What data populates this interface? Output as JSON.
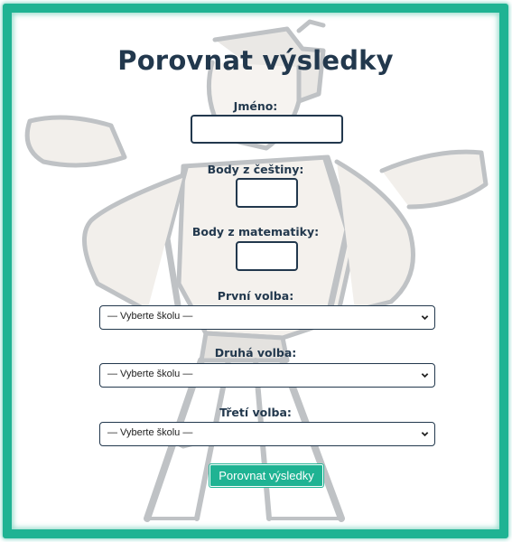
{
  "form": {
    "title": "Porovnat výsledky",
    "name_label": "Jméno:",
    "name_value": "",
    "czech_label": "Body z češtiny:",
    "czech_value": "",
    "math_label": "Body z matematiky:",
    "math_value": "",
    "choice1_label": "První volba:",
    "choice1_value": "— Vyberte školu —",
    "choice2_label": "Druhá volba:",
    "choice2_value": "— Vyberte školu —",
    "choice3_label": "Třetí volba:",
    "choice3_value": "— Vyberte školu —",
    "submit_label": "Porovnat výsledky"
  },
  "theme": {
    "accent": "#1fb393",
    "text": "#22384d",
    "illustration": "#c9c6c0"
  },
  "icons": {
    "select_arrow": "chevron-down-icon",
    "background": "shrugging-person-illustration"
  }
}
